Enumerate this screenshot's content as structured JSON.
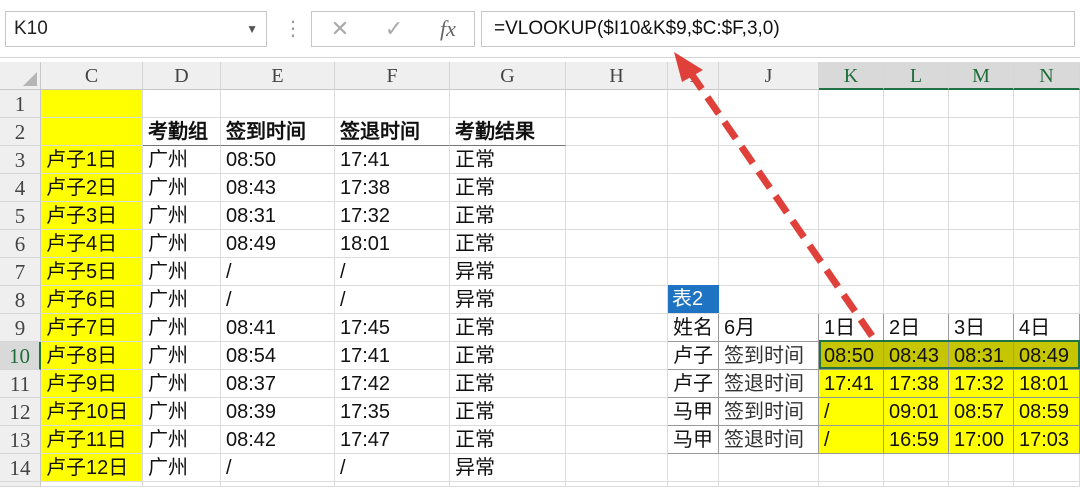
{
  "formula_bar": {
    "name_box": "K10",
    "cancel_icon": "✕",
    "enter_icon": "✓",
    "fx_label": "fx",
    "formula": "=VLOOKUP($I10&K$9,$C:$F,3,0)"
  },
  "columns": [
    "C",
    "D",
    "E",
    "F",
    "G",
    "H",
    "I",
    "J",
    "K",
    "L",
    "M",
    "N"
  ],
  "rows": [
    "1",
    "2",
    "3",
    "4",
    "5",
    "6",
    "7",
    "8",
    "9",
    "10",
    "11",
    "12",
    "13",
    "14"
  ],
  "active_cell": "K10",
  "table1": {
    "headers": [
      "考勤组",
      "签到时间",
      "签退时间",
      "考勤结果"
    ],
    "rows": [
      {
        "c": "卢子1日",
        "d": "广州",
        "e": "08:50",
        "f": "17:41",
        "g": "正常"
      },
      {
        "c": "卢子2日",
        "d": "广州",
        "e": "08:43",
        "f": "17:38",
        "g": "正常"
      },
      {
        "c": "卢子3日",
        "d": "广州",
        "e": "08:31",
        "f": "17:32",
        "g": "正常"
      },
      {
        "c": "卢子4日",
        "d": "广州",
        "e": "08:49",
        "f": "18:01",
        "g": "正常"
      },
      {
        "c": "卢子5日",
        "d": "广州",
        "e": "/",
        "f": "/",
        "g": "异常"
      },
      {
        "c": "卢子6日",
        "d": "广州",
        "e": "/",
        "f": "/",
        "g": "异常"
      },
      {
        "c": "卢子7日",
        "d": "广州",
        "e": "08:41",
        "f": "17:45",
        "g": "正常"
      },
      {
        "c": "卢子8日",
        "d": "广州",
        "e": "08:54",
        "f": "17:41",
        "g": "正常"
      },
      {
        "c": "卢子9日",
        "d": "广州",
        "e": "08:37",
        "f": "17:42",
        "g": "正常"
      },
      {
        "c": "卢子10日",
        "d": "广州",
        "e": "08:39",
        "f": "17:35",
        "g": "正常"
      },
      {
        "c": "卢子11日",
        "d": "广州",
        "e": "08:42",
        "f": "17:47",
        "g": "正常"
      },
      {
        "c": "卢子12日",
        "d": "广州",
        "e": "/",
        "f": "/",
        "g": "异常"
      }
    ]
  },
  "table2": {
    "label": "表2",
    "header": {
      "name": "姓名",
      "month": "6月",
      "days": [
        "1日",
        "2日",
        "3日",
        "4日"
      ]
    },
    "rows": [
      {
        "name": "卢子",
        "type": "签到时间",
        "values": [
          "08:50",
          "08:43",
          "08:31",
          "08:49"
        ]
      },
      {
        "name": "卢子",
        "type": "签退时间",
        "values": [
          "17:41",
          "17:38",
          "17:32",
          "18:01"
        ]
      },
      {
        "name": "马甲",
        "type": "签到时间",
        "values": [
          "/",
          "09:01",
          "08:57",
          "08:59"
        ]
      },
      {
        "name": "马甲",
        "type": "签退时间",
        "values": [
          "/",
          "16:59",
          "17:00",
          "17:03"
        ]
      }
    ]
  },
  "colors": {
    "highlight": "#ffff00",
    "selected_range": "#c5c500",
    "table_label_bg": "#1f73c3",
    "excel_green": "#217346",
    "arrow": "#e0403a"
  }
}
